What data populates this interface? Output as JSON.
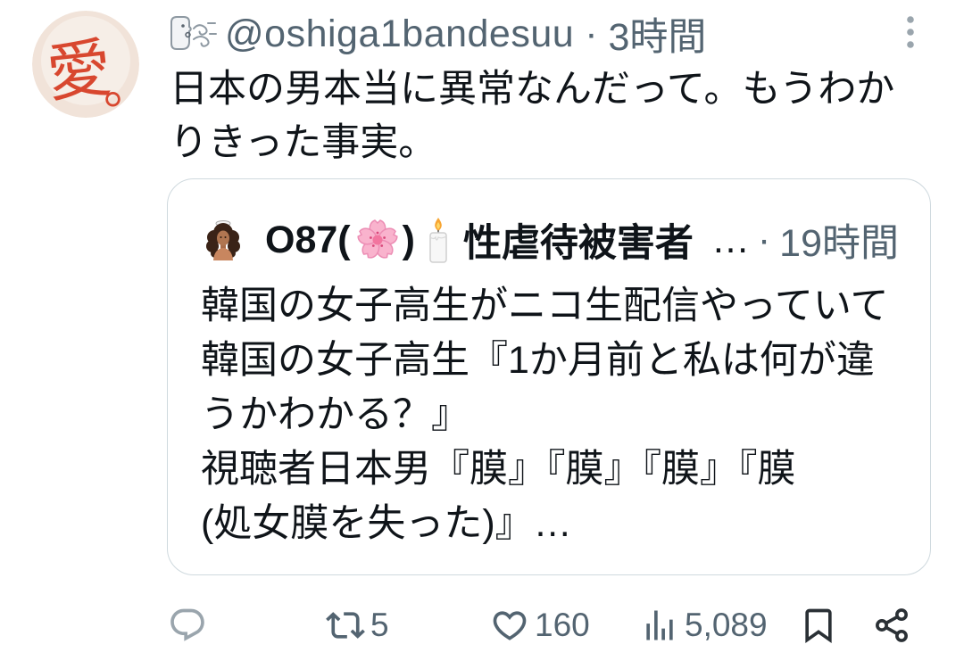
{
  "tweet": {
    "avatar": {
      "glyph": "愛",
      "mark": "。"
    },
    "display_name_icon": "wind-face-icon",
    "handle": "@oshiga1bandesuu",
    "separator": "·",
    "time": "3時間",
    "more_icon": "more-vertical-icon",
    "text_lines": [
      "日本の男本当に異常なんだって。もうわか",
      "りきった事実。"
    ]
  },
  "quote": {
    "avatar_icon": "quote-author-avatar",
    "name": {
      "prefix": "O87(",
      "flower_icon": "cherry-blossom-icon",
      "paren_close": ")",
      "candle_icon": "candle-icon",
      "main": "性虐待被害者",
      "ellipsis": "…"
    },
    "separator": "·",
    "time": "19時間",
    "text_lines": [
      "韓国の女子高生がニコ生配信やっていて",
      "韓国の女子高生『1か月前と私は何が違",
      "うかわかる？』",
      "視聴者日本男『膜』『膜』『膜』『膜",
      "(処女膜を失った)』…"
    ]
  },
  "actions": {
    "reply": {
      "icon": "reply-icon"
    },
    "retweet": {
      "icon": "retweet-icon",
      "count": "5"
    },
    "like": {
      "icon": "heart-icon",
      "count": "160"
    },
    "views": {
      "icon": "views-icon",
      "count": "5,089"
    },
    "bookmark": {
      "icon": "bookmark-icon"
    },
    "share": {
      "icon": "share-icon"
    }
  },
  "colors": {
    "text": "#0f1419",
    "secondary": "#536471",
    "border": "#cfd9de",
    "avatar_ink": "#d8472f",
    "avatar_background": "#f4e9e1",
    "blossom": "#f9b3cd"
  }
}
